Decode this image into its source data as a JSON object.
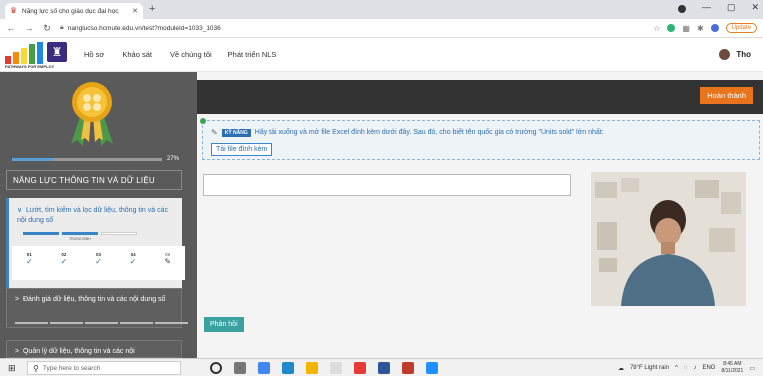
{
  "browser": {
    "tab_title": "Năng lực số cho giáo dục đại học",
    "url": "nanglucso.hcmute.edu.vn/test?moduleId=1033_1036",
    "update_label": "Update"
  },
  "header": {
    "logo_text": "PATHWAYS FOR EMPLOY",
    "nav": [
      "Hồ sơ",
      "Khảo sát",
      "Về chúng tôi",
      "Phát triển NLS"
    ],
    "user_name": "Tho"
  },
  "sidebar": {
    "progress_value": 0.27,
    "progress_label": "27%",
    "category_title": "NĂNG LỰC THÔNG TIN VÀ DỮ LIỆU",
    "active_card": {
      "title": "Lướt, tìm kiếm và lọc dữ liệu, thông tin và các nội dung số",
      "level_label": "TRUNG BÌNH",
      "steps": [
        {
          "num": "01",
          "mark": "✓"
        },
        {
          "num": "02",
          "mark": "✓"
        },
        {
          "num": "03",
          "mark": "✓"
        },
        {
          "num": "04",
          "mark": "✓"
        },
        {
          "num": "05",
          "mark": "✎"
        }
      ]
    },
    "card2_title": "Đánh giá dữ liệu, thông tin và các nội dung số",
    "card3_title": "Quản lý dữ liệu, thông tin và các nội"
  },
  "main": {
    "finish_label": "Hoàn thành",
    "skill_badge": "KỸ NĂNG",
    "question": "Hãy tải xuống và mở file Excel đính kèm dưới đây. Sau đó, cho biết tên quốc gia có trường \"Units sold\" lớn nhất:",
    "attach_label": "Tải file đính kèm",
    "feedback_label": "Phản hồi"
  },
  "taskbar": {
    "search_placeholder": "Type here to search",
    "weather": "78°F Light rain",
    "lang": "ENG",
    "time": "8:45 AM",
    "date": "8/11/2021"
  },
  "colors": {
    "accent_blue": "#2e6fb0",
    "finish_orange": "#e8741e",
    "feedback_teal": "#3aa1a1",
    "sidebar_gray": "#5a5a5a"
  }
}
